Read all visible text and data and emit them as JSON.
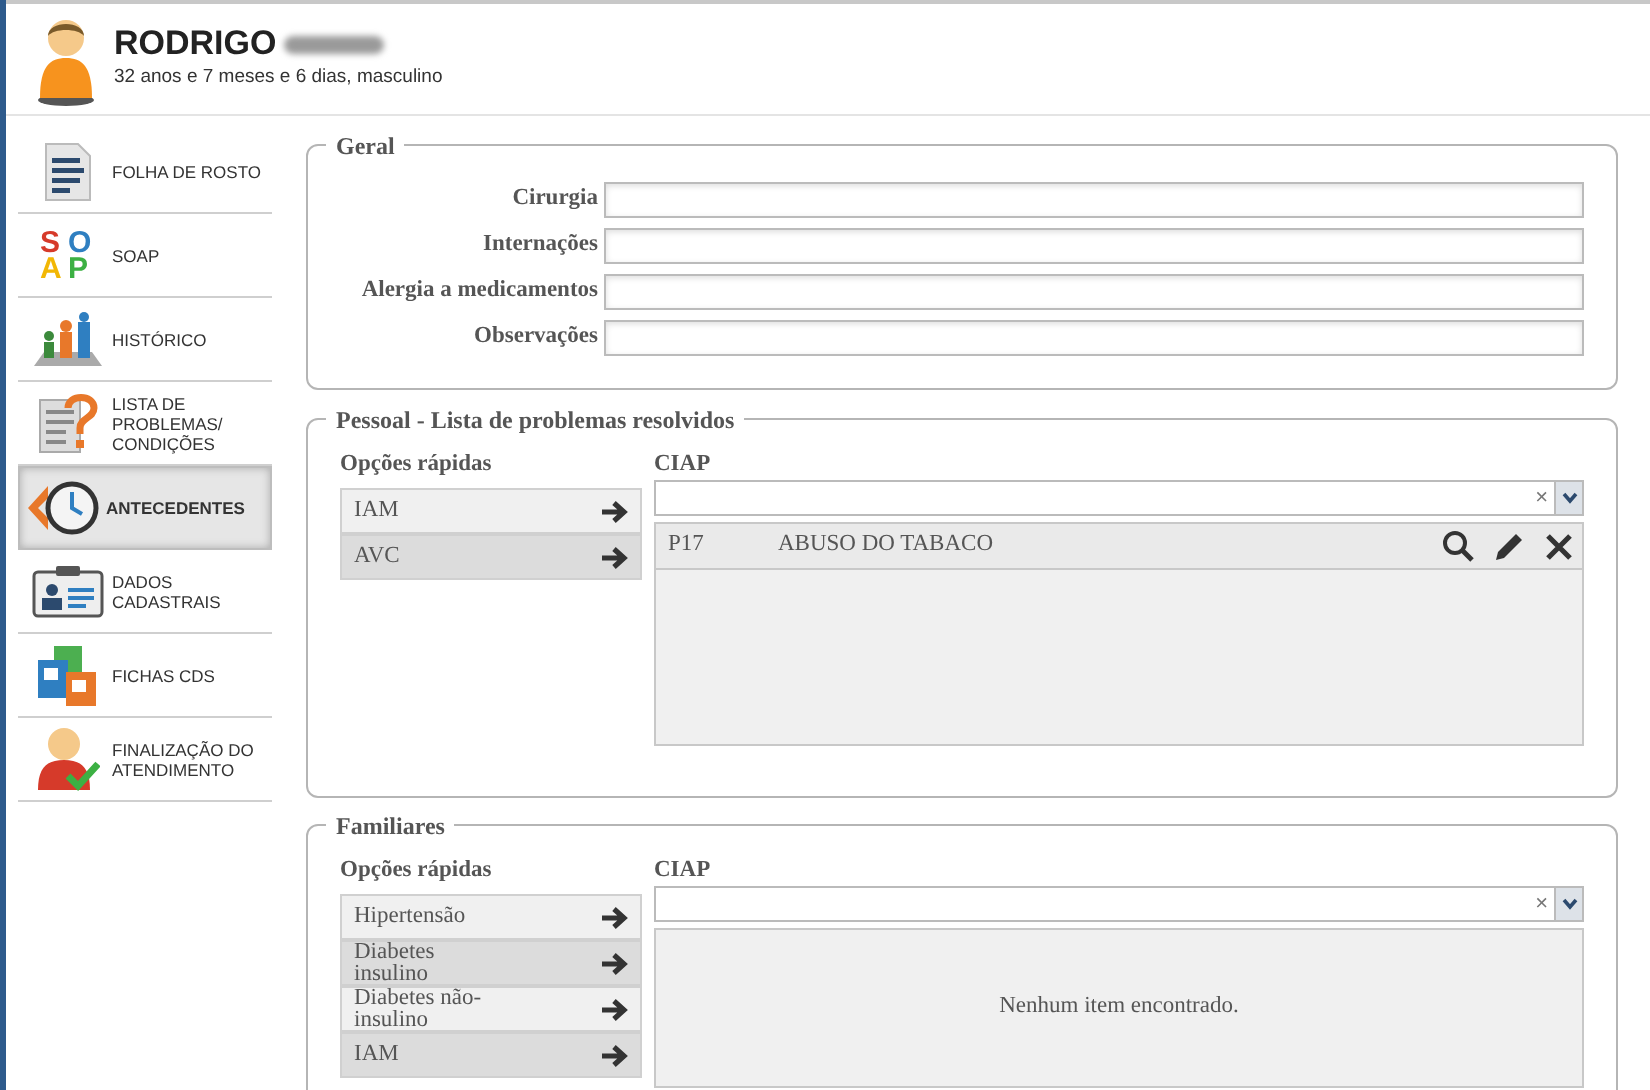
{
  "patient": {
    "name": "RODRIGO",
    "details": "32 anos e 7 meses e 6 dias, masculino"
  },
  "sidebar": {
    "items": [
      {
        "kind": "document",
        "label": "FOLHA DE ROSTO",
        "selected": false
      },
      {
        "kind": "soap",
        "icon_letters": [
          "S",
          "O",
          "A",
          "P"
        ],
        "label": "SOAP",
        "selected": false
      },
      {
        "kind": "history",
        "label": "HISTÓRICO",
        "selected": false
      },
      {
        "kind": "problems",
        "label": "LISTA DE PROBLEMAS/ CONDIÇÕES",
        "selected": false
      },
      {
        "kind": "clock",
        "label": "ANTECEDENTES",
        "selected": true
      },
      {
        "kind": "id-card",
        "label": "DADOS CADASTRAIS",
        "selected": false
      },
      {
        "kind": "forms",
        "label": "FICHAS CDS",
        "selected": false
      },
      {
        "kind": "finish",
        "label": "FINALIZAÇÃO DO ATENDIMENTO",
        "selected": false
      }
    ]
  },
  "geral": {
    "title": "Geral",
    "fields": [
      {
        "label": "Cirurgia"
      },
      {
        "label": "Internações"
      },
      {
        "label": "Alergia a medicamentos"
      },
      {
        "label": "Observações"
      }
    ]
  },
  "pessoal": {
    "title": "Pessoal - Lista de problemas resolvidos",
    "quick_title": "Opções rápidas",
    "ciap_title": "CIAP",
    "clear": "×",
    "quick_options": [
      {
        "label": "IAM"
      },
      {
        "label": "AVC"
      }
    ],
    "rows": [
      {
        "code": "P17",
        "description": "ABUSO DO TABACO"
      }
    ]
  },
  "familiares": {
    "title": "Familiares",
    "quick_title": "Opções rápidas",
    "ciap_title": "CIAP",
    "clear": "×",
    "quick_options": [
      {
        "label": "Hipertensão"
      },
      {
        "label": "Diabetes insulino"
      },
      {
        "label": "Diabetes não-insulino"
      },
      {
        "label": "IAM"
      }
    ],
    "empty": "Nenhum item encontrado."
  }
}
